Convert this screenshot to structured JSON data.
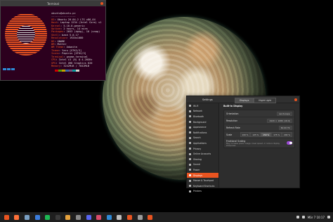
{
  "terminal": {
    "title": "Terminal",
    "lines": [
      {
        "k": "",
        "v": "ubuntu@ubuntu-pc"
      },
      {
        "k": "",
        "v": "----------------"
      },
      {
        "k": "OS",
        "v": "Ubuntu 20.04.2 LTS x86_64"
      },
      {
        "k": "Host",
        "v": "Laptop 1234 (Intel Core) v1"
      },
      {
        "k": "Kernel",
        "v": "5.10.0-generic"
      },
      {
        "k": "Uptime",
        "v": "2 hours, 14 mins"
      },
      {
        "k": "Packages",
        "v": "2053 (dpkg), 10 (snap)"
      },
      {
        "k": "Shell",
        "v": "bash 5.0.17"
      },
      {
        "k": "Resolution",
        "v": "1920x1080"
      },
      {
        "k": "DE",
        "v": "GNOME"
      },
      {
        "k": "WM",
        "v": "Mutter"
      },
      {
        "k": "WM Theme",
        "v": "Adwaita"
      },
      {
        "k": "Theme",
        "v": "Yaru [GTK2/3]"
      },
      {
        "k": "Icons",
        "v": "Papirus [GTK2/3]"
      },
      {
        "k": "Terminal",
        "v": "gnome-terminal"
      },
      {
        "k": "CPU",
        "v": "Intel i5 (8) @ 4.20GHz"
      },
      {
        "k": "GPU",
        "v": "Intel UHD Graphics 620"
      },
      {
        "k": "Memory",
        "v": "3242MiB / 7842MiB"
      }
    ]
  },
  "settings": {
    "title": "Settings",
    "tabs": [
      "Displays",
      "Night Light"
    ],
    "sidebar": [
      "Wi-Fi",
      "Network",
      "Bluetooth",
      "Background",
      "Appearance",
      "Notifications",
      "Search",
      "Applications",
      "Privacy",
      "Online Accounts",
      "Sharing",
      "Sound",
      "Power",
      "Displays",
      "Mouse & Touchpad",
      "Keyboard Shortcuts",
      "Printers"
    ],
    "active_index": 13,
    "section": "Built-in Display",
    "rows": {
      "orientation_label": "Orientation",
      "orientation_value": "Landscape",
      "resolution_label": "Resolution",
      "resolution_value": "1920 × 1080 (16:9)",
      "refresh_label": "Refresh Rate",
      "refresh_value": "60.00 Hz",
      "scale_label": "Scale",
      "scale_options": [
        "100 %",
        "125 %",
        "150 %",
        "175 %",
        "200 %"
      ],
      "scale_active": 2,
      "fractional_label": "Fractional Scaling",
      "fractional_sub": "May increase power usage, lower speed, or reduce display sharpness."
    }
  },
  "dock": {
    "clock": "Mär 7  10:17",
    "icons": [
      {
        "name": "app-grid-icon",
        "color": "#e95420"
      },
      {
        "name": "firefox-icon",
        "color": "#ff7139"
      },
      {
        "name": "files-icon",
        "color": "#7aa0c4"
      },
      {
        "name": "shield-icon",
        "color": "#3b7ddd"
      },
      {
        "name": "spotify-icon",
        "color": "#1db954"
      },
      {
        "name": "terminal-icon",
        "color": "#3a3a3a"
      },
      {
        "name": "folder-icon",
        "color": "#e6a23c"
      },
      {
        "name": "image-icon",
        "color": "#8a8a8a"
      },
      {
        "name": "discord-icon",
        "color": "#5865f2"
      },
      {
        "name": "music-icon",
        "color": "#d94b6b"
      },
      {
        "name": "vscode-icon",
        "color": "#2e89d6"
      },
      {
        "name": "document-icon",
        "color": "#bfbfbf"
      },
      {
        "name": "store-icon",
        "color": "#e95420"
      },
      {
        "name": "settings-icon",
        "color": "#9b9b9b"
      },
      {
        "name": "ubuntu-icon",
        "color": "#e95420"
      }
    ]
  },
  "colors": {
    "accent": "#e95420",
    "toggle_on": "#9b4ad6",
    "terminal_bg": "#2c001e",
    "swatches": [
      "#2c001e",
      "#cc0000",
      "#4e9a06",
      "#c4a000",
      "#3465a4",
      "#75507b",
      "#06989a",
      "#d3d7cf"
    ]
  }
}
